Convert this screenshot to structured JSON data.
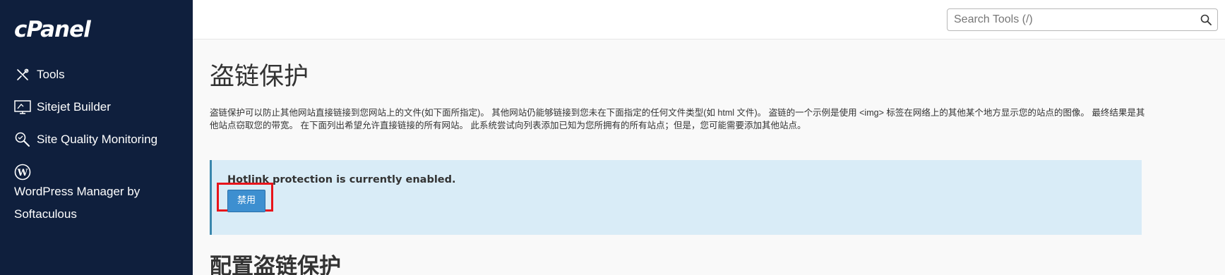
{
  "sidebar": {
    "logo": "cPanel",
    "items": [
      {
        "label": "Tools",
        "icon": "tools-icon"
      },
      {
        "label": "Sitejet Builder",
        "icon": "sitejet-monitor-icon"
      },
      {
        "label": "Site Quality Monitoring",
        "icon": "search-magnifier-icon"
      },
      {
        "label": "WordPress Manager by Softaculous",
        "icon": "wordpress-icon"
      }
    ]
  },
  "search": {
    "placeholder": "Search Tools (/)",
    "icon": "search-icon"
  },
  "main": {
    "title": "盗链保护",
    "description": "盗链保护可以防止其他网站直接链接到您网站上的文件(如下面所指定)。 其他网站仍能够链接到您未在下面指定的任何文件类型(如 html 文件)。 盗链的一个示例是使用 <img> 标签在网络上的其他某个地方显示您的站点的图像。 最终结果是其他站点窃取您的带宽。 在下面列出希望允许直接链接的所有网站。 此系统尝试向列表添加已知为您所拥有的所有站点；但是，您可能需要添加其他站点。",
    "alert": {
      "text": "Hotlink protection is currently enabled.",
      "button_label": "禁用"
    },
    "section_title": "配置盗链保护"
  },
  "colors": {
    "sidebar_bg": "#0f1f3d",
    "alert_bg": "#d9ecf7",
    "button_bg": "#3d8fd0",
    "highlight": "#e8141b"
  }
}
